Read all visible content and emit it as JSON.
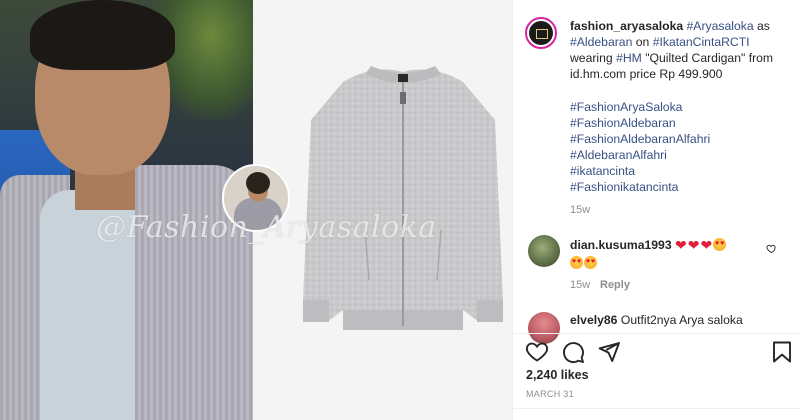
{
  "post": {
    "username": "fashion_aryasaloka",
    "caption_parts": [
      {
        "text": "#Aryasaloka",
        "type": "tag"
      },
      {
        "text": " as ",
        "type": "text"
      },
      {
        "text": "#Aldebaran",
        "type": "tag"
      },
      {
        "text": " on ",
        "type": "text"
      },
      {
        "text": "#IkatanCintaRCTI",
        "type": "tag"
      },
      {
        "text": " wearing ",
        "type": "text"
      },
      {
        "text": "#HM",
        "type": "tag"
      },
      {
        "text": " \"Quilted Cardigan\" from id.hm.com price Rp 499.900",
        "type": "text"
      }
    ],
    "hashtags": [
      "#FashionAryaSaloka",
      "#FashionAldebaran",
      "#FashionAldebaranAlfahri",
      "#AldebaranAlfahri",
      "#ikatancinta",
      "#Fashionikatancinta"
    ],
    "caption_age": "15w",
    "watermark": "@Fashion_Aryasaloka"
  },
  "comments": [
    {
      "username": "dian.kusuma1993",
      "age": "15w",
      "reply_label": "Reply",
      "emojis": [
        "red-heart",
        "red-heart",
        "red-heart",
        "heart-eyes",
        "heart-eyes",
        "heart-eyes"
      ]
    },
    {
      "username": "elvely86",
      "text": "Outfit2nya Arya saloka"
    }
  ],
  "actions": {
    "like_icon": "heart-outline-icon",
    "comment_icon": "speech-bubble-icon",
    "share_icon": "paper-plane-icon",
    "save_icon": "bookmark-icon"
  },
  "likes_count": "2,240 likes",
  "post_date": "MARCH 31",
  "colors": {
    "link": "#385185",
    "text": "#262626",
    "muted": "#8e8e8e",
    "heart_red": "#e0203a"
  }
}
